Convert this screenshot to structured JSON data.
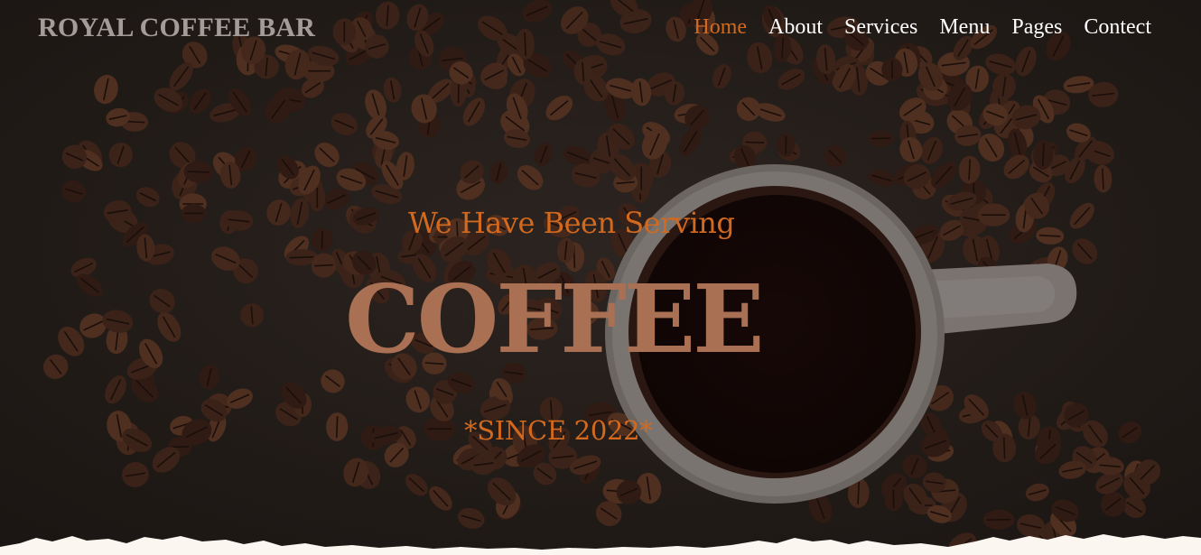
{
  "brand": {
    "name": "ROYAL COFFEE BAR"
  },
  "nav": {
    "items": [
      {
        "label": "Home",
        "active": true
      },
      {
        "label": "About"
      },
      {
        "label": "Services"
      },
      {
        "label": "Menu"
      },
      {
        "label": "Pages"
      },
      {
        "label": "Contect"
      }
    ]
  },
  "hero": {
    "subtitle": "We Have Been Serving",
    "headline": "COFFEE",
    "since": "*SINCE 2022*",
    "background": "coffee-beans-and-cup-photo"
  },
  "colors": {
    "accent": "#d2691e",
    "headline": "#a97053",
    "brand": "#a49c98",
    "background": "#241d1a"
  }
}
